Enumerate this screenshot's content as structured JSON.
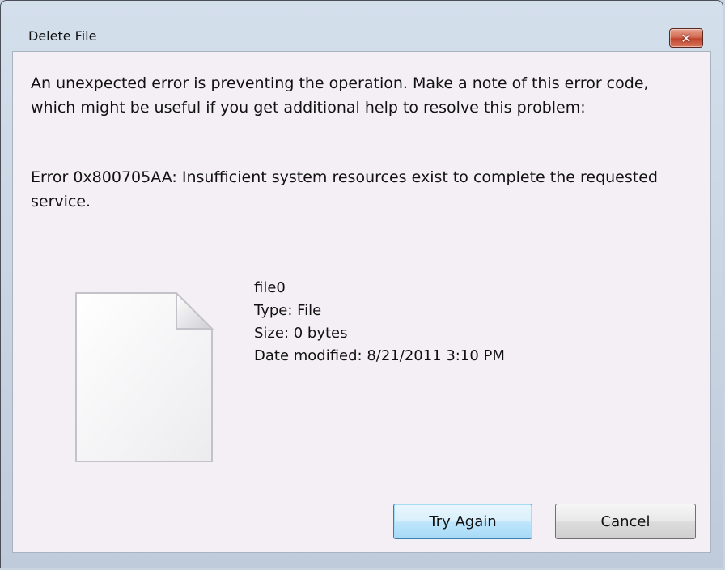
{
  "window": {
    "title": "Delete File",
    "close_glyph": "✕"
  },
  "message": {
    "intro": "An unexpected error is preventing the operation. Make a note of this error code, which might be useful if you get additional help to resolve this problem:",
    "error": "Error 0x800705AA: Insufficient system resources exist to complete the requested service."
  },
  "file": {
    "icon": "blank-file-icon",
    "name": "file0",
    "type": "Type: File",
    "size": "Size: 0 bytes",
    "date_modified": "Date modified: 8/21/2011 3:10 PM"
  },
  "buttons": {
    "try_again": "Try Again",
    "cancel": "Cancel"
  }
}
